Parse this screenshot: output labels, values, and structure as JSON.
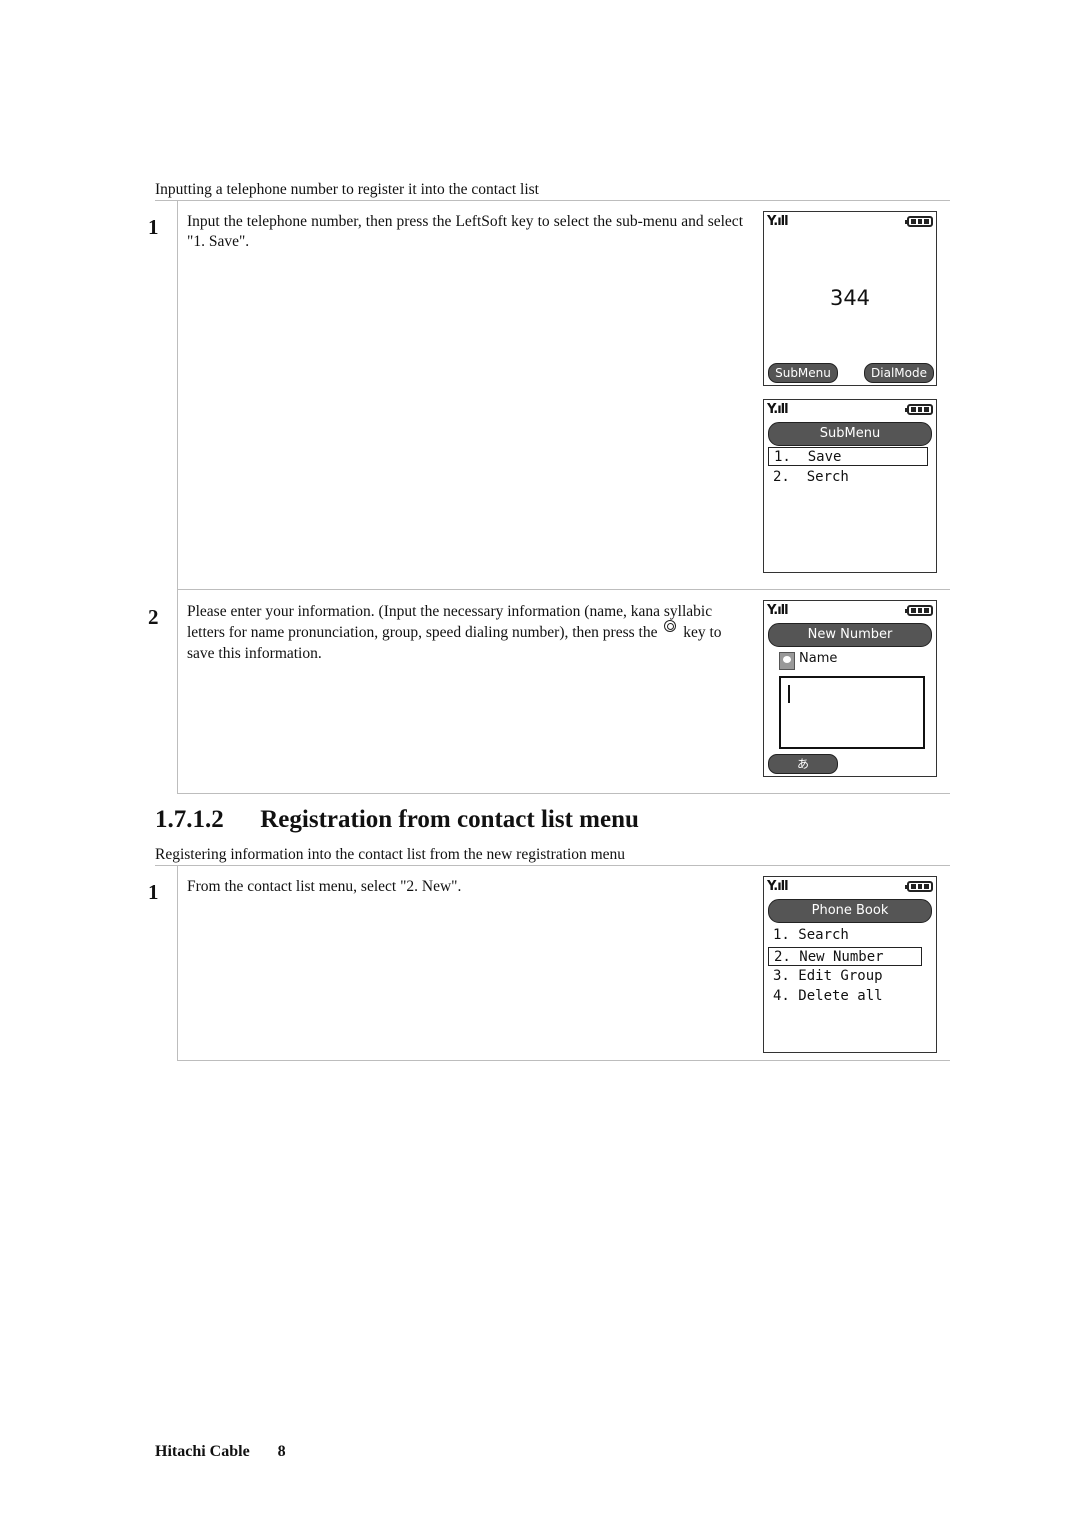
{
  "section1": {
    "caption": "Inputting a telephone number to register it into the contact list",
    "steps": [
      {
        "number": "1",
        "text": "Input the telephone number, then press the LeftSoft key to select the sub-menu and select \"1. Save\"."
      },
      {
        "number": "2",
        "text_before_icon": "Please enter your information. (Input the necessary information (name, kana syllabic letters for name pronunciation, group, speed dialing number), then press the",
        "icon": "center-key-icon",
        "text_after_icon": "key to save this information."
      }
    ]
  },
  "section2": {
    "number": "1.7.1.2",
    "title": "Registration from contact list menu",
    "caption": "Registering information into the contact list from the new registration menu",
    "steps": [
      {
        "number": "1",
        "text": "From the contact list menu, select \"2. New\"."
      }
    ]
  },
  "screens": {
    "dial": {
      "signal_icon": "signal-antenna-icon",
      "battery_icon": "battery-full-icon",
      "number": "344",
      "left_softkey": "SubMenu",
      "right_softkey": "DialMode"
    },
    "submenu": {
      "title": "SubMenu",
      "items": [
        "1.  Save",
        "2.  Serch"
      ],
      "selected_index": 0
    },
    "new_number": {
      "title": "New Number",
      "field_icon": "person-icon",
      "field_label": "Name",
      "field_value": "",
      "softkey": "あ"
    },
    "phone_book": {
      "title": "Phone Book",
      "items": [
        "1. Search",
        "2. New Number",
        "3. Edit Group",
        "4. Delete all"
      ],
      "selected_index": 1
    }
  },
  "footer": {
    "company": "Hitachi Cable",
    "page": "8"
  },
  "colors": {
    "rule": "#bdbdbd",
    "screen_bar": "#555555"
  }
}
